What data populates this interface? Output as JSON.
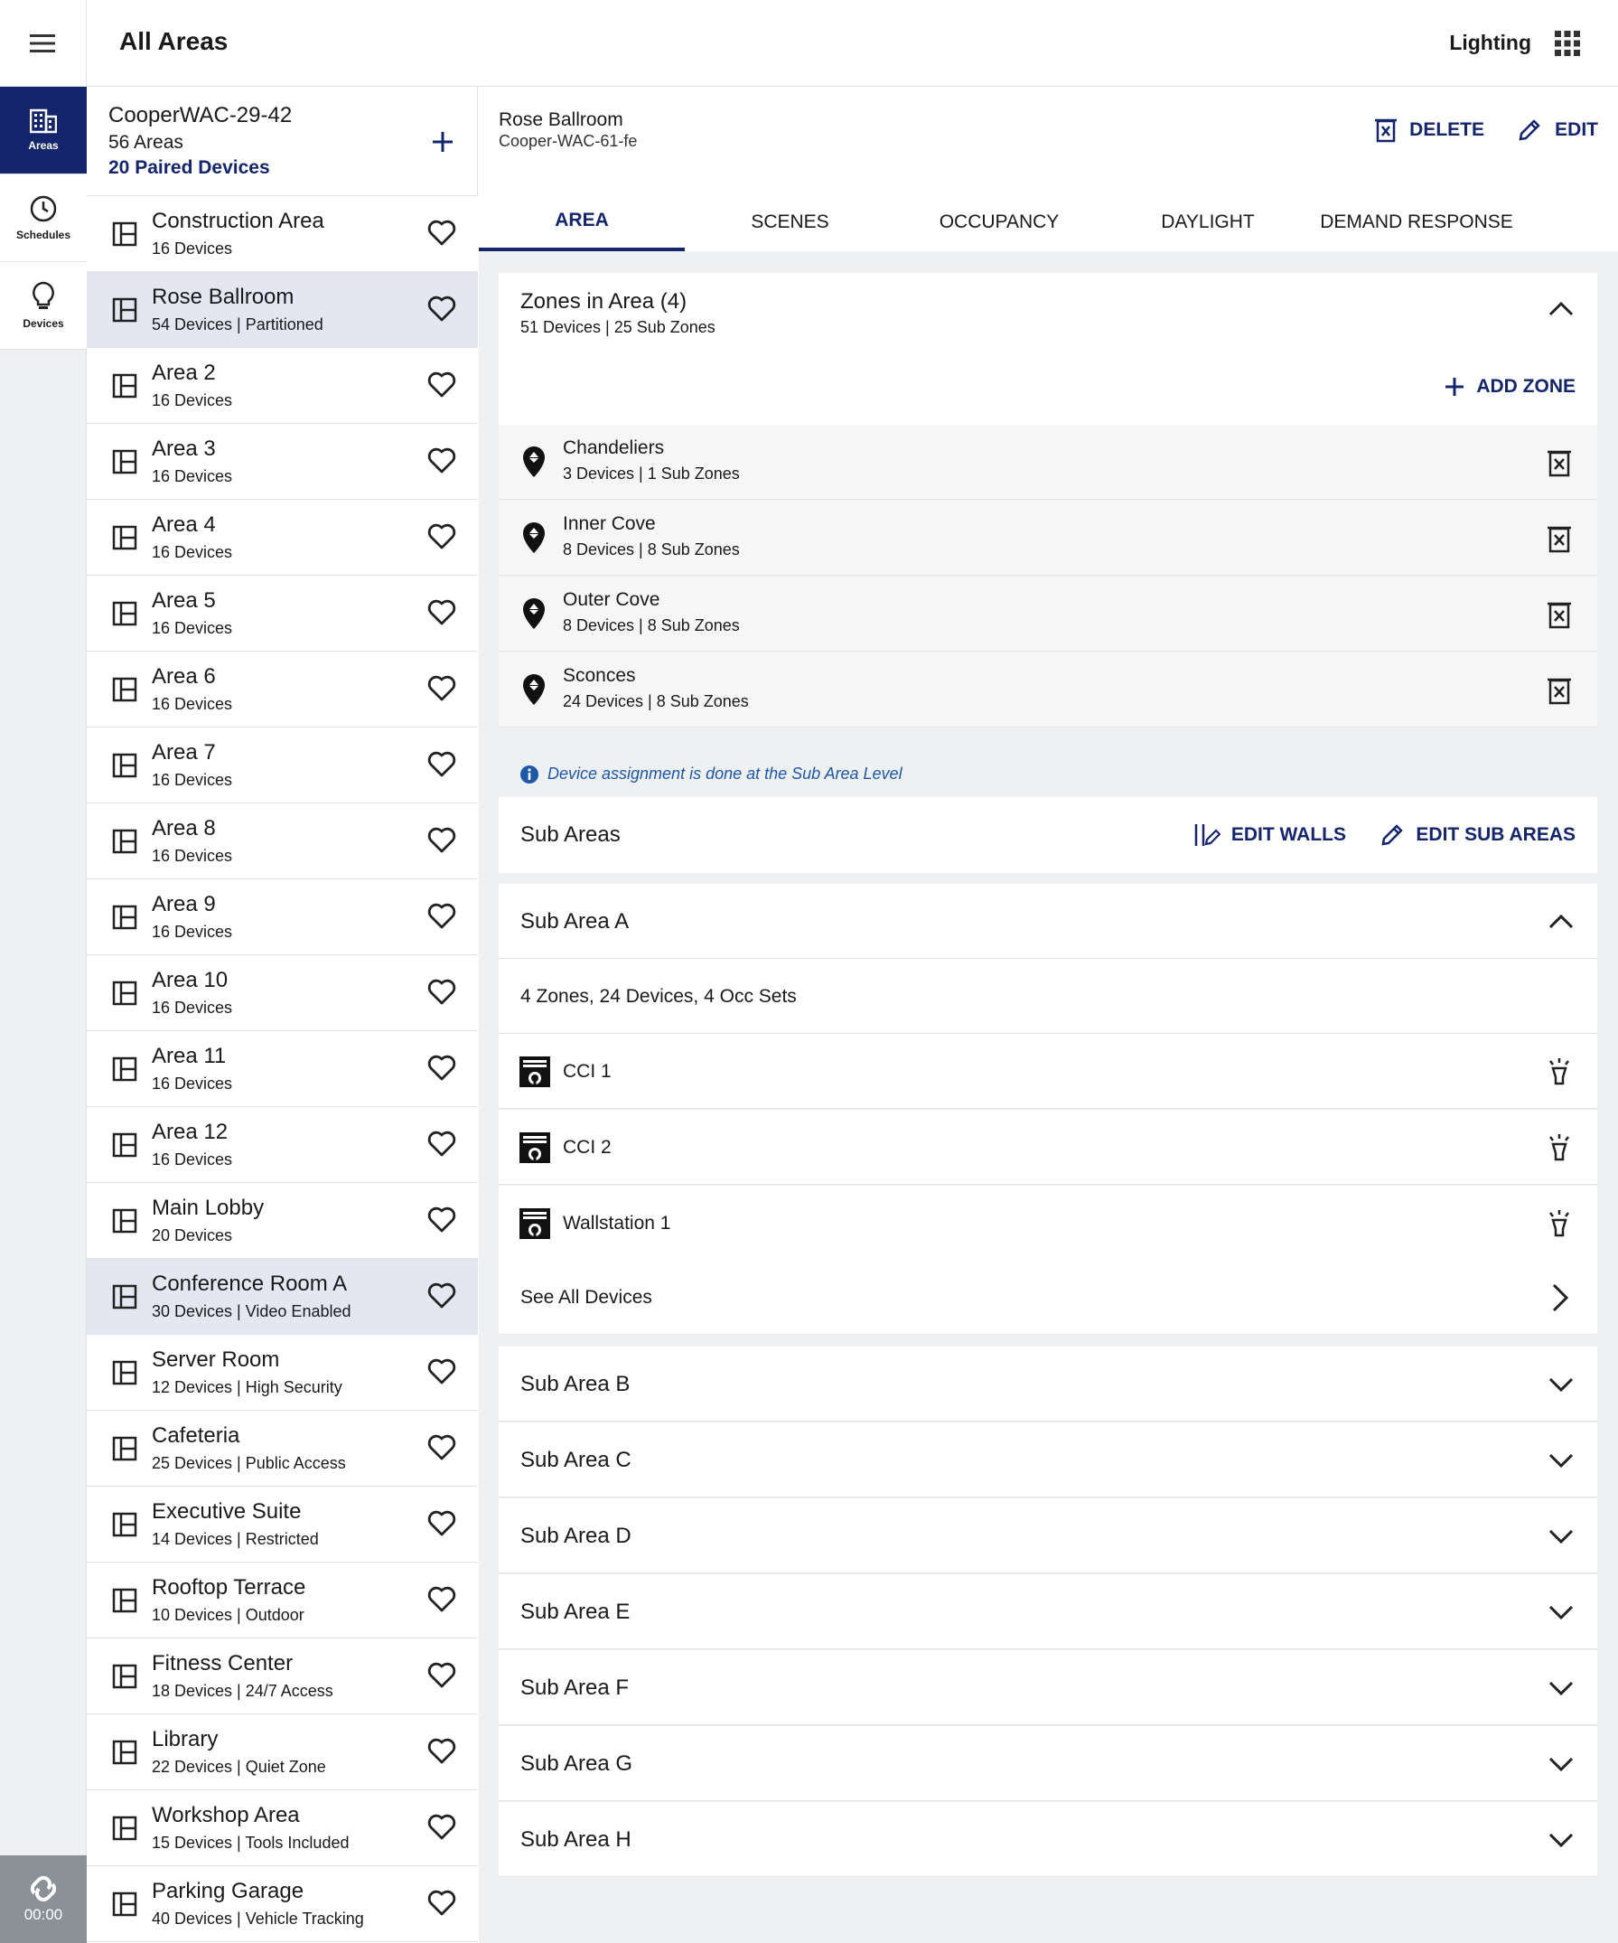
{
  "header": {
    "title": "All Areas",
    "app_name": "Lighting"
  },
  "rail": {
    "items": [
      {
        "label": "Areas",
        "icon": "building-icon",
        "active": true
      },
      {
        "label": "Schedules",
        "icon": "clock-icon",
        "active": false
      },
      {
        "label": "Devices",
        "icon": "lightbulb-icon",
        "active": false
      }
    ],
    "timer": "00:00"
  },
  "site": {
    "name": "CooperWAC-29-42",
    "areas": "56 Areas",
    "paired": "20 Paired Devices"
  },
  "areas": [
    {
      "name": "Construction Area",
      "sub": "16 Devices"
    },
    {
      "name": "Rose Ballroom",
      "sub": "54 Devices | Partitioned",
      "selected": true
    },
    {
      "name": "Area 2",
      "sub": "16 Devices"
    },
    {
      "name": "Area 3",
      "sub": "16 Devices"
    },
    {
      "name": "Area 4",
      "sub": "16 Devices"
    },
    {
      "name": "Area 5",
      "sub": "16 Devices"
    },
    {
      "name": "Area 6",
      "sub": "16 Devices"
    },
    {
      "name": "Area 7",
      "sub": "16 Devices"
    },
    {
      "name": "Area 8",
      "sub": "16 Devices"
    },
    {
      "name": "Area 9",
      "sub": "16 Devices"
    },
    {
      "name": "Area 10",
      "sub": "16 Devices"
    },
    {
      "name": "Area 11",
      "sub": "16 Devices"
    },
    {
      "name": "Area 12",
      "sub": "16 Devices"
    },
    {
      "name": "Main Lobby",
      "sub": "20 Devices"
    },
    {
      "name": "Conference Room A",
      "sub": "30 Devices | Video Enabled",
      "selected": true
    },
    {
      "name": "Server Room",
      "sub": "12 Devices | High Security"
    },
    {
      "name": "Cafeteria",
      "sub": "25 Devices | Public Access"
    },
    {
      "name": "Executive Suite",
      "sub": "14 Devices | Restricted"
    },
    {
      "name": "Rooftop Terrace",
      "sub": "10 Devices | Outdoor"
    },
    {
      "name": "Fitness Center",
      "sub": "18 Devices | 24/7 Access"
    },
    {
      "name": "Library",
      "sub": "22 Devices | Quiet Zone"
    },
    {
      "name": "Workshop Area",
      "sub": "15 Devices | Tools Included"
    },
    {
      "name": "Parking Garage",
      "sub": "40 Devices | Vehicle Tracking"
    }
  ],
  "detail": {
    "title": "Rose Ballroom",
    "subtitle": "Cooper-WAC-61-fe",
    "delete_label": "DELETE",
    "edit_label": "EDIT",
    "tabs": [
      "AREA",
      "SCENES",
      "OCCUPANCY",
      "DAYLIGHT",
      "DEMAND RESPONSE"
    ],
    "active_tab": "AREA",
    "zones_title": "Zones in Area (4)",
    "zones_summary": "51 Devices | 25 Sub Zones",
    "add_zone_label": "ADD ZONE",
    "zones": [
      {
        "name": "Chandeliers",
        "sub": "3 Devices  |  1 Sub Zones"
      },
      {
        "name": "Inner Cove",
        "sub": "8 Devices  |  8 Sub Zones"
      },
      {
        "name": "Outer Cove",
        "sub": "8 Devices  |  8 Sub Zones"
      },
      {
        "name": "Sconces",
        "sub": "24 Devices  |  8 Sub Zones"
      }
    ],
    "note": "Device assignment is done at the Sub Area Level",
    "sub_areas_title": "Sub Areas",
    "edit_walls_label": "EDIT WALLS",
    "edit_sub_areas_label": "EDIT SUB AREAS",
    "sub_area_a": {
      "name": "Sub Area A",
      "summary": "4 Zones, 24 Devices, 4 Occ Sets",
      "devices": [
        "CCI 1",
        "CCI 2",
        "Wallstation 1"
      ],
      "see_all": "See All Devices"
    },
    "sub_areas_collapsed": [
      "Sub Area B",
      "Sub Area C",
      "Sub Area D",
      "Sub Area E",
      "Sub Area F",
      "Sub Area G",
      "Sub Area H"
    ]
  },
  "colors": {
    "accent": "#14256b",
    "selected_row": "#e4e7f2",
    "panel_bg": "#eef0f1",
    "info": "#1c57a8"
  }
}
